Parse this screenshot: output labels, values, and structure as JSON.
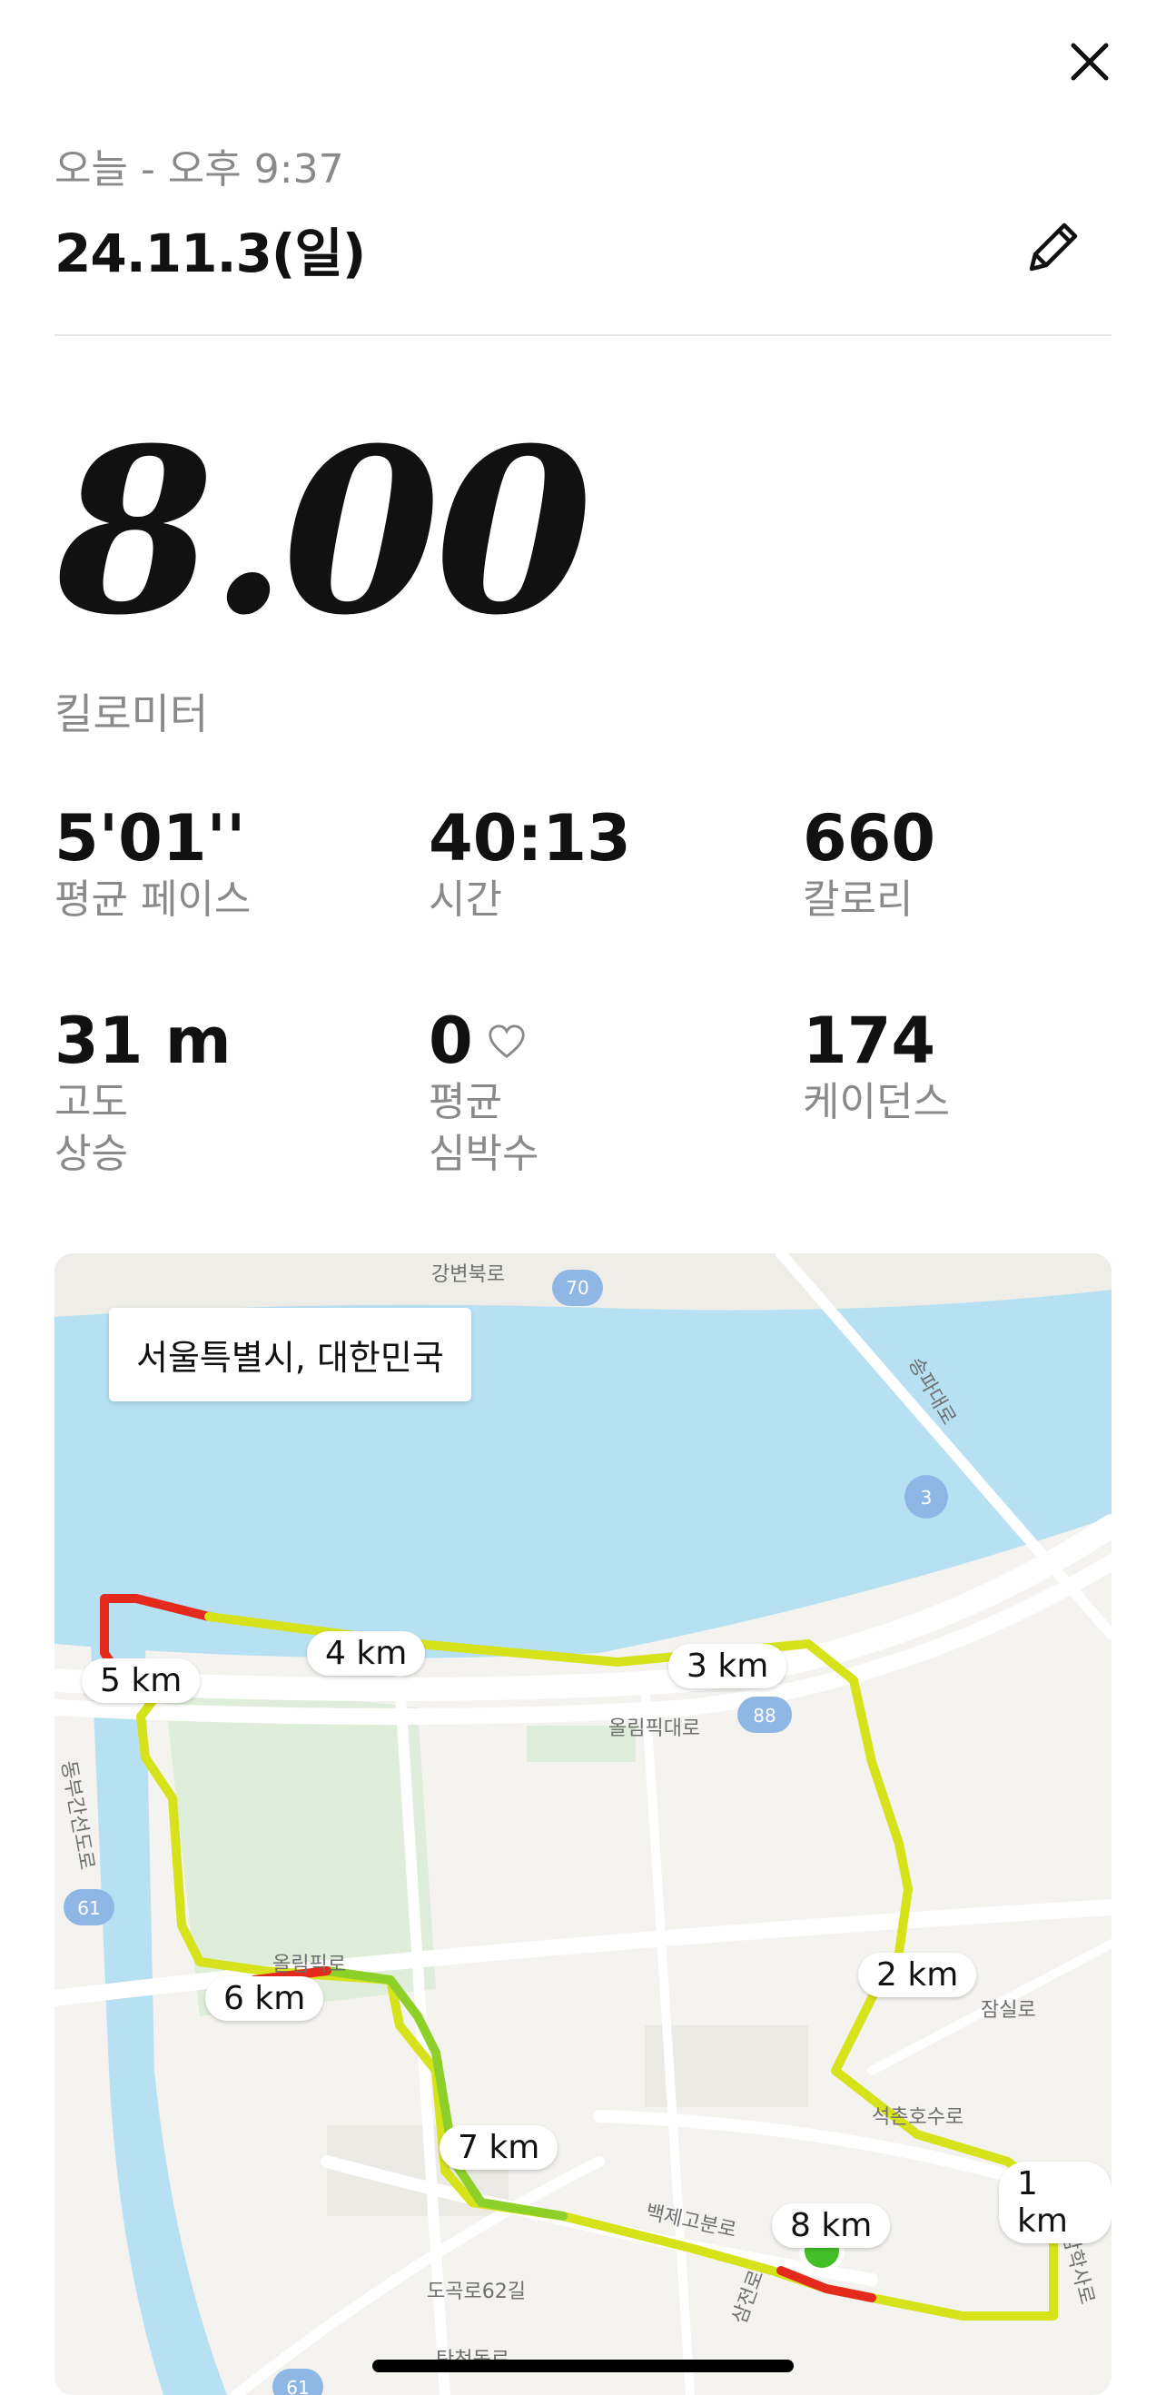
{
  "header": {
    "subdate": "오늘 - 오후 9:37",
    "title": "24.11.3(일)"
  },
  "distance": {
    "value": "8.00",
    "unit": "킬로미터"
  },
  "stats": [
    {
      "value": "5'01''",
      "label": "평균 페이스"
    },
    {
      "value": "40:13",
      "label": "시간"
    },
    {
      "value": "660",
      "label": "칼로리"
    },
    {
      "value": "31 m",
      "label": "고도\n상승"
    },
    {
      "value": "0",
      "label": "평균\n심박수"
    },
    {
      "value": "174",
      "label": "케이던스"
    }
  ],
  "map": {
    "location": "서울특별시, 대한민국",
    "km_markers": [
      "1 km",
      "2 km",
      "3 km",
      "4 km",
      "5 km",
      "6 km",
      "7 km",
      "8 km"
    ],
    "road_labels": [
      "강변북로",
      "송파대로",
      "올림픽대로",
      "올림픽로",
      "잠실로",
      "석촌호수로",
      "백제고분로",
      "삼전로",
      "탄천동로",
      "도곡로62길",
      "동부간선도로",
      "삼학사로"
    ],
    "route_signs": [
      "70",
      "3",
      "88",
      "61",
      "61"
    ]
  },
  "colors": {
    "water": "#b7e1f3",
    "land": "#f4f3ef",
    "park": "#dfeeda",
    "route_yellow": "#d6e21a",
    "route_green": "#8ed02a",
    "route_red": "#e42a1d",
    "position_dot": "#43c025"
  },
  "icons": {
    "close": "close-icon",
    "edit": "pencil-icon",
    "heart": "heart-outline-icon"
  }
}
